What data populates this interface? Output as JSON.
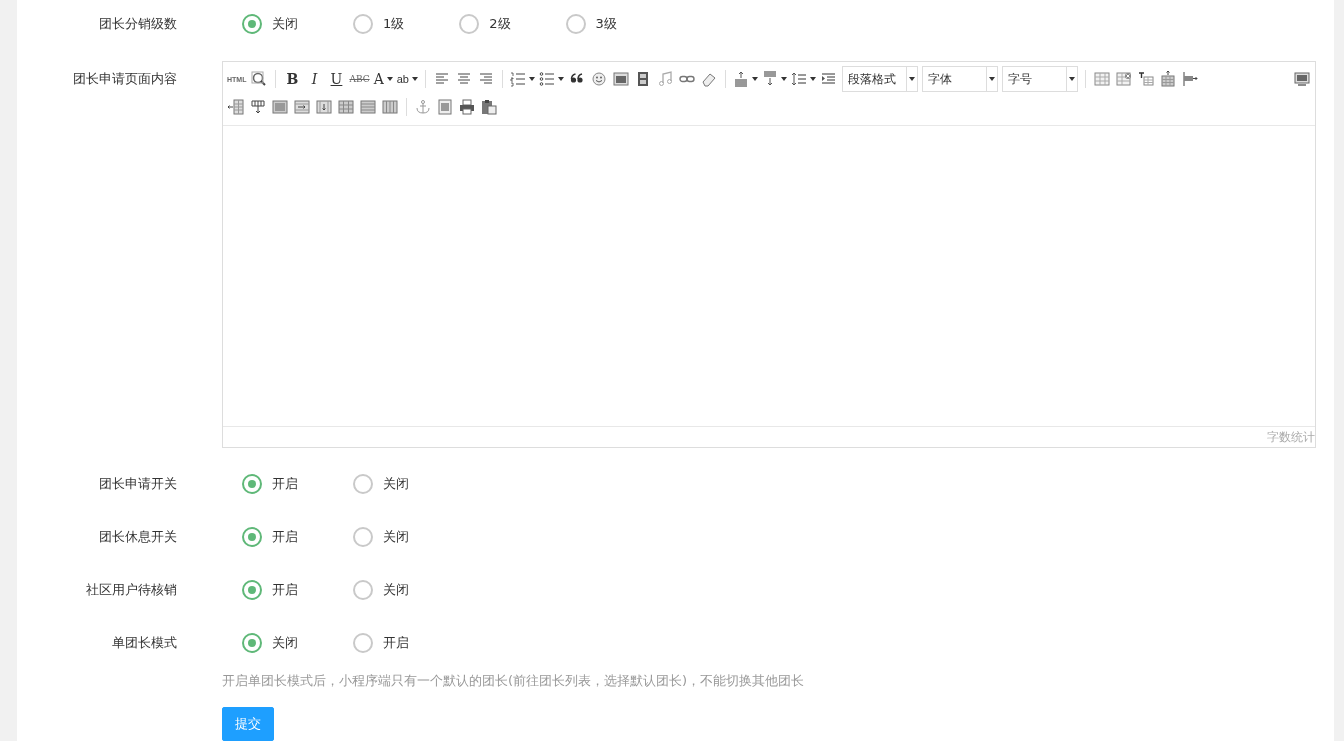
{
  "settings": [
    {
      "kind": "radio",
      "label": "团长分销级数",
      "options": [
        {
          "label": "关闭",
          "selected": true
        },
        {
          "label": "1级",
          "selected": false
        },
        {
          "label": "2级",
          "selected": false
        },
        {
          "label": "3级",
          "selected": false
        }
      ]
    },
    {
      "kind": "editor",
      "label": "团长申请页面内容",
      "toolbar": [
        [
          {
            "kind": "glyph",
            "label": "HTML"
          },
          {
            "kind": "button"
          },
          {
            "kind": "separator"
          },
          {
            "kind": "glyph",
            "label": "B"
          },
          {
            "kind": "glyph",
            "label": "I"
          },
          {
            "kind": "glyph",
            "label": "U"
          },
          {
            "kind": "glyph",
            "label": "ABC"
          },
          {
            "kind": "glyph-dropdown",
            "label": "A"
          },
          {
            "kind": "glyph-dropdown",
            "label": "ab"
          },
          {
            "kind": "separator"
          },
          {
            "kind": "button"
          },
          {
            "kind": "button"
          },
          {
            "kind": "button"
          },
          {
            "kind": "separator"
          },
          {
            "kind": "dropdown"
          },
          {
            "kind": "dropdown"
          },
          {
            "kind": "button"
          },
          {
            "kind": "button"
          },
          {
            "kind": "button"
          },
          {
            "kind": "button"
          },
          {
            "kind": "button"
          },
          {
            "kind": "button"
          },
          {
            "kind": "button"
          },
          {
            "kind": "separator"
          },
          {
            "kind": "dropdown"
          },
          {
            "kind": "dropdown"
          },
          {
            "kind": "dropdown"
          },
          {
            "kind": "button"
          },
          {
            "kind": "select",
            "label": "段落格式"
          },
          {
            "kind": "select",
            "label": "字体"
          },
          {
            "kind": "select",
            "label": "字号"
          },
          {
            "kind": "separator"
          },
          {
            "kind": "button"
          },
          {
            "kind": "button"
          },
          {
            "kind": "button"
          },
          {
            "kind": "button"
          },
          {
            "kind": "button"
          },
          {
            "kind": "spacer"
          },
          {
            "kind": "button"
          }
        ],
        [
          {
            "kind": "button"
          },
          {
            "kind": "button"
          },
          {
            "kind": "button"
          },
          {
            "kind": "button"
          },
          {
            "kind": "button"
          },
          {
            "kind": "button"
          },
          {
            "kind": "button"
          },
          {
            "kind": "button"
          },
          {
            "kind": "separator"
          },
          {
            "kind": "button"
          },
          {
            "kind": "button"
          },
          {
            "kind": "button"
          },
          {
            "kind": "button"
          }
        ]
      ],
      "word_count": "字数统计"
    },
    {
      "kind": "radio",
      "label": "团长申请开关",
      "options": [
        {
          "label": "开启",
          "selected": true
        },
        {
          "label": "关闭",
          "selected": false
        }
      ]
    },
    {
      "kind": "radio",
      "label": "团长休息开关",
      "options": [
        {
          "label": "开启",
          "selected": true
        },
        {
          "label": "关闭",
          "selected": false
        }
      ]
    },
    {
      "kind": "radio",
      "label": "社区用户待核销",
      "options": [
        {
          "label": "开启",
          "selected": true
        },
        {
          "label": "关闭",
          "selected": false
        }
      ]
    },
    {
      "kind": "radio",
      "label": "单团长模式",
      "options": [
        {
          "label": "关闭",
          "selected": true
        },
        {
          "label": "开启",
          "selected": false
        }
      ]
    }
  ],
  "hint": "开启单团长模式后，小程序端只有一个默认的团长(前往团长列表，选择默认团长)，不能切换其他团长",
  "submit": "提交"
}
